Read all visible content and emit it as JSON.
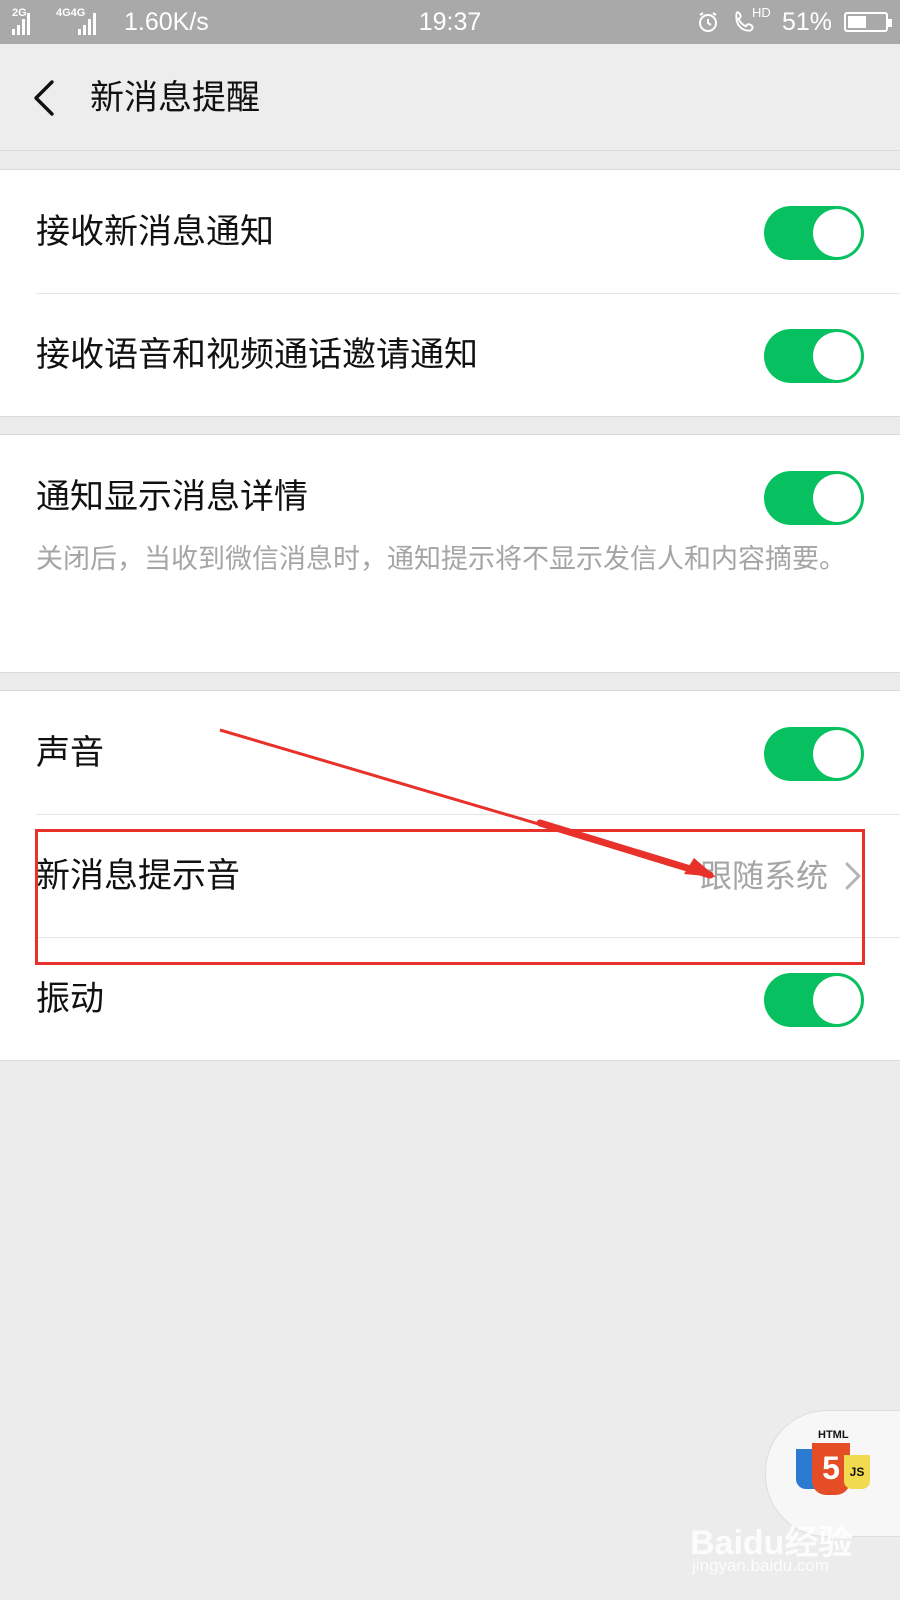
{
  "status_bar": {
    "net1": "2G",
    "net2": "4G4G",
    "speed": "1.60K/s",
    "time": "19:37",
    "call_label": "HD",
    "battery_text": "51%",
    "battery_level": 0.51
  },
  "header": {
    "title": "新消息提醒"
  },
  "settings": {
    "receive_new": {
      "label": "接收新消息通知",
      "on": true
    },
    "receive_call": {
      "label": "接收语音和视频通话邀请通知",
      "on": true
    },
    "show_details": {
      "label": "通知显示消息详情",
      "desc": "关闭后，当收到微信消息时，通知提示将不显示发信人和内容摘要。",
      "on": true
    },
    "sound": {
      "label": "声音",
      "on": true
    },
    "tone": {
      "label": "新消息提示音",
      "value": "跟随系统"
    },
    "vibrate": {
      "label": "振动",
      "on": true
    }
  },
  "badge": {
    "html_text": "HTML",
    "number": "5",
    "js_text": "JS"
  },
  "watermark": {
    "brand": "Baidu经验",
    "url": "jingyan.baidu.com"
  },
  "colors": {
    "accent": "#07c160",
    "annotation": "#e8312b"
  }
}
